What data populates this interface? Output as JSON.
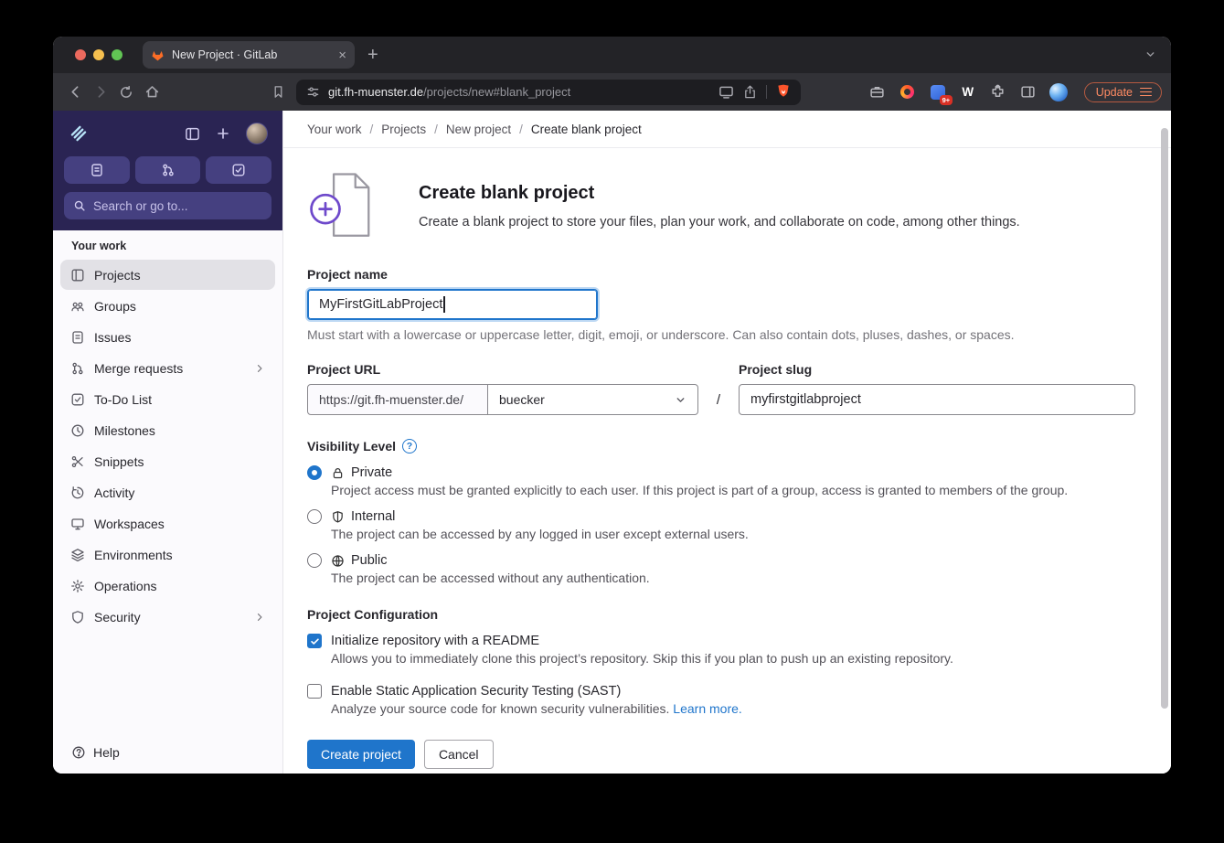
{
  "browser": {
    "tab_title": "New Project · GitLab",
    "url_host": "git.fh-muenster.de",
    "url_path": "/projects/new#blank_project",
    "update_label": "Update",
    "extension_badge": "9+",
    "extension_w": "W"
  },
  "sidebar": {
    "search_placeholder": "Search or go to...",
    "section": "Your work",
    "items": [
      {
        "label": "Projects",
        "active": true
      },
      {
        "label": "Groups",
        "active": false
      },
      {
        "label": "Issues",
        "active": false
      },
      {
        "label": "Merge requests",
        "active": false,
        "chevron": true
      },
      {
        "label": "To-Do List",
        "active": false
      },
      {
        "label": "Milestones",
        "active": false
      },
      {
        "label": "Snippets",
        "active": false
      },
      {
        "label": "Activity",
        "active": false
      },
      {
        "label": "Workspaces",
        "active": false
      },
      {
        "label": "Environments",
        "active": false
      },
      {
        "label": "Operations",
        "active": false
      },
      {
        "label": "Security",
        "active": false,
        "chevron": true
      }
    ],
    "help": "Help"
  },
  "breadcrumb": {
    "separator": "/",
    "items": [
      "Your work",
      "Projects",
      "New project",
      "Create blank project"
    ]
  },
  "form": {
    "title": "Create blank project",
    "subtitle": "Create a blank project to store your files, plan your work, and collaborate on code, among other things.",
    "name": {
      "label": "Project name",
      "value": "MyFirstGitLabProject",
      "help": "Must start with a lowercase or uppercase letter, digit, emoji, or underscore. Can also contain dots, pluses, dashes, or spaces."
    },
    "url": {
      "label": "Project URL",
      "prefix": "https://git.fh-muenster.de/",
      "namespace": "buecker",
      "separator": "/"
    },
    "slug": {
      "label": "Project slug",
      "value": "myfirstgitlabproject"
    },
    "visibility": {
      "label": "Visibility Level",
      "options": [
        {
          "name": "Private",
          "selected": true,
          "desc": "Project access must be granted explicitly to each user. If this project is part of a group, access is granted to members of the group."
        },
        {
          "name": "Internal",
          "selected": false,
          "desc": "The project can be accessed by any logged in user except external users."
        },
        {
          "name": "Public",
          "selected": false,
          "desc": "The project can be accessed without any authentication."
        }
      ]
    },
    "config": {
      "label": "Project Configuration",
      "checkboxes": [
        {
          "label": "Initialize repository with a README",
          "checked": true,
          "desc": "Allows you to immediately clone this project’s repository. Skip this if you plan to push up an existing repository."
        },
        {
          "label": "Enable Static Application Security Testing (SAST)",
          "checked": false,
          "desc": "Analyze your source code for known security vulnerabilities.",
          "link": "Learn more."
        }
      ]
    },
    "submit": "Create project",
    "cancel": "Cancel"
  },
  "colors": {
    "accent_blue": "#1f75cb",
    "sidebar_purple": "#2a2453",
    "brave_orange": "#fb542b",
    "update_orange": "#ff8b63"
  }
}
